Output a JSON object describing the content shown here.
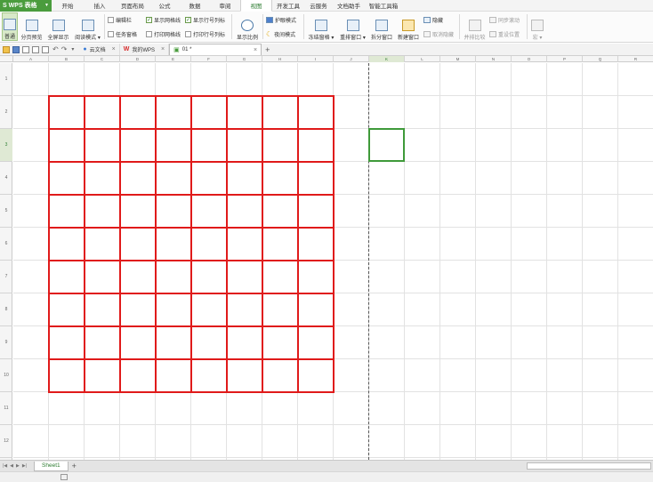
{
  "app": {
    "name": "WPS 表格"
  },
  "menu_tabs": [
    {
      "label": "开始"
    },
    {
      "label": "插入"
    },
    {
      "label": "页面布局"
    },
    {
      "label": "公式"
    },
    {
      "label": "数据"
    },
    {
      "label": "审阅"
    },
    {
      "label": "视图",
      "active": true
    },
    {
      "label": "开发工具"
    },
    {
      "label": "云服务"
    },
    {
      "label": "文档助手"
    },
    {
      "label": "智能工具箱"
    }
  ],
  "ribbon": {
    "normal": "普通",
    "page_break": "分页预览",
    "full_screen": "全屏显示",
    "reading_mode": "阅读模式",
    "formula_bar": "编辑栏",
    "task_pane": "任务窗格",
    "show_gridlines": "显示网格线",
    "print_gridlines": "打印网格线",
    "show_headings": "显示行号列标",
    "print_headings": "打印行号列标",
    "zoom": "显示比例",
    "eye_mode": "护眼模式",
    "night_mode": "夜间模式",
    "freeze_panes": "冻结窗格",
    "rearrange": "重排窗口",
    "split": "拆分窗口",
    "new_window": "新建窗口",
    "hide": "隐藏",
    "unhide": "取消隐藏",
    "side_by_side": "并排比较",
    "sync_scroll": "同步滚动",
    "reset_position": "重设位置",
    "macro": "宏"
  },
  "doc_tabs": [
    {
      "label": "云文档"
    },
    {
      "label": "我的WPS"
    },
    {
      "label": "01 *",
      "active": true
    }
  ],
  "columns": [
    "A",
    "B",
    "C",
    "D",
    "E",
    "F",
    "G",
    "H",
    "I",
    "J",
    "K",
    "L",
    "M",
    "N",
    "O",
    "P",
    "Q",
    "R"
  ],
  "rows": [
    "1",
    "2",
    "3",
    "4",
    "5",
    "6",
    "7",
    "8",
    "9",
    "10",
    "11",
    "12"
  ],
  "selected_cell": "K3",
  "sheets": [
    {
      "label": "Sheet1"
    }
  ],
  "colors": {
    "accent": "#4a9c3d",
    "table_border": "#e01a1a",
    "selection": "#3f9a3a"
  }
}
